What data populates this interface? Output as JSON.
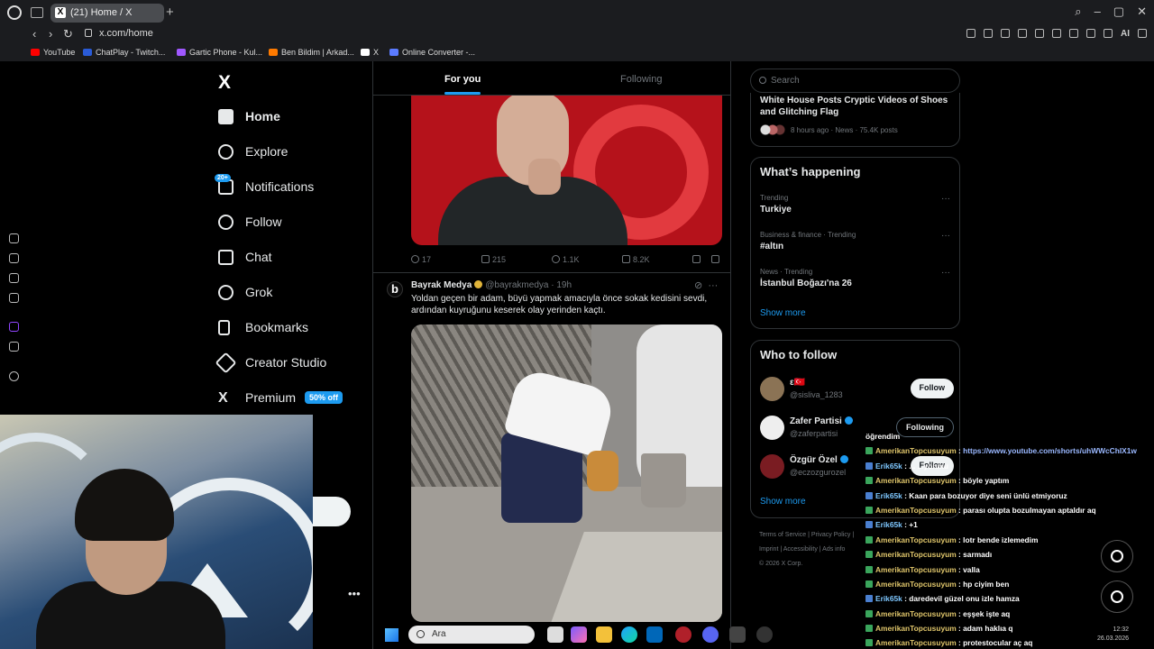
{
  "browser": {
    "tab_title": "(21) Home / X",
    "url": "x.com/home",
    "bookmarks": [
      {
        "label": "YouTube",
        "color": "#ff0000"
      },
      {
        "label": "ChatPlay - Twitch...",
        "color": "#2a5bd7"
      },
      {
        "label": "Gartic Phone - Kul...",
        "color": "#a058ff"
      },
      {
        "label": "Ben Bildim | Arkad...",
        "color": "#ff7a00"
      },
      {
        "label": "X",
        "color": "#ffffff"
      },
      {
        "label": "Online Converter -...",
        "color": "#5b7bff"
      }
    ]
  },
  "nav": {
    "logo": "X",
    "items": [
      {
        "label": "Home",
        "icon": "home-icon"
      },
      {
        "label": "Explore",
        "icon": "search-icon"
      },
      {
        "label": "Notifications",
        "icon": "bell-icon",
        "badge": "20+"
      },
      {
        "label": "Follow",
        "icon": "follow-icon"
      },
      {
        "label": "Chat",
        "icon": "mail-icon"
      },
      {
        "label": "Grok",
        "icon": "grok-icon"
      },
      {
        "label": "Bookmarks",
        "icon": "bookmark-icon"
      },
      {
        "label": "Creator Studio",
        "icon": "rocket-icon"
      },
      {
        "label": "Premium",
        "icon": "x-premium-icon",
        "badge": "50% off"
      }
    ]
  },
  "feed": {
    "tabs": {
      "for_you": "For you",
      "following": "Following"
    },
    "post1_stats": {
      "replies": "17",
      "reposts": "215",
      "likes": "1.1K",
      "views": "8.2K"
    },
    "post2": {
      "name": "Bayrak Medya",
      "handle": "@bayrakmedya",
      "time": "· 19h",
      "text": "Yoldan geçen bir adam, büyü yapmak amacıyla önce sokak kedisini sevdi, ardından kuyruğunu keserek olay yerinden kaçtı."
    }
  },
  "right": {
    "search_placeholder": "Search",
    "news": {
      "title": "White House Posts Cryptic Videos of Shoes and Glitching Flag",
      "meta": "8 hours ago · News · 75.4K posts"
    },
    "happening": {
      "title": "What’s happening",
      "trends": [
        {
          "context": "Trending",
          "topic": "Turkiye"
        },
        {
          "context": "Business & finance · Trending",
          "topic": "#altın"
        },
        {
          "context": "News · Trending",
          "topic": "İstanbul Boğazı'na 26"
        }
      ],
      "show_more": "Show more"
    },
    "who_to_follow": {
      "title": "Who to follow",
      "accounts": [
        {
          "name": "ε🇹🇷",
          "handle": "@sisliva_1283",
          "button": "Follow",
          "state": "follow"
        },
        {
          "name": "Zafer Partisi",
          "handle": "@zaferpartisi",
          "button": "Following",
          "state": "following"
        },
        {
          "name": "Özgür Özel",
          "handle": "@eczozgurozel",
          "button": "Follow",
          "state": "follow"
        }
      ],
      "show_more": "Show more"
    },
    "footer": {
      "row1": "Terms of Service  |  Privacy Policy  |",
      "row2": "Imprint  |  Accessibility  |  Ads info",
      "row3": "© 2026 X Corp."
    }
  },
  "chat": [
    {
      "user": "",
      "text": "öğrendim"
    },
    {
      "user": "AmerikanTopcusuyum",
      "text": "https://www.youtube.com/shorts/uhWWcChIX1w",
      "link": true
    },
    {
      "user": "Erik65k",
      "text": "... ...yonmu"
    },
    {
      "user": "AmerikanTopcusuyum",
      "text": "böyle yaptım"
    },
    {
      "user": "Erik65k",
      "text": "Kaan para bozuyor diye seni ünlü etmiyoruz"
    },
    {
      "user": "AmerikanTopcusuyum",
      "text": "parası olupta bozulmayan aptaldır aq"
    },
    {
      "user": "Erik65k",
      "text": "+1"
    },
    {
      "user": "AmerikanTopcusuyum",
      "text": "lotr bende izlemedim"
    },
    {
      "user": "AmerikanTopcusuyum",
      "text": "sarmadı"
    },
    {
      "user": "AmerikanTopcusuyum",
      "text": "valla"
    },
    {
      "user": "AmerikanTopcusuyum",
      "text": "hp ciyim ben"
    },
    {
      "user": "Erik65k",
      "text": "daredevil güzel onu izle hamza"
    },
    {
      "user": "AmerikanTopcusuyum",
      "text": "eşşek işte aq"
    },
    {
      "user": "AmerikanTopcusuyum",
      "text": "adam haklıa q"
    },
    {
      "user": "AmerikanTopcusuyum",
      "text": "protestocular aç aq"
    }
  ],
  "taskbar": {
    "search_placeholder": "Ara",
    "time": "12:32",
    "date": "26.03.2026"
  },
  "colors": {
    "accent": "#1d9bf0",
    "background": "#000000",
    "text": "#e7e9ea",
    "muted": "#71767b"
  }
}
